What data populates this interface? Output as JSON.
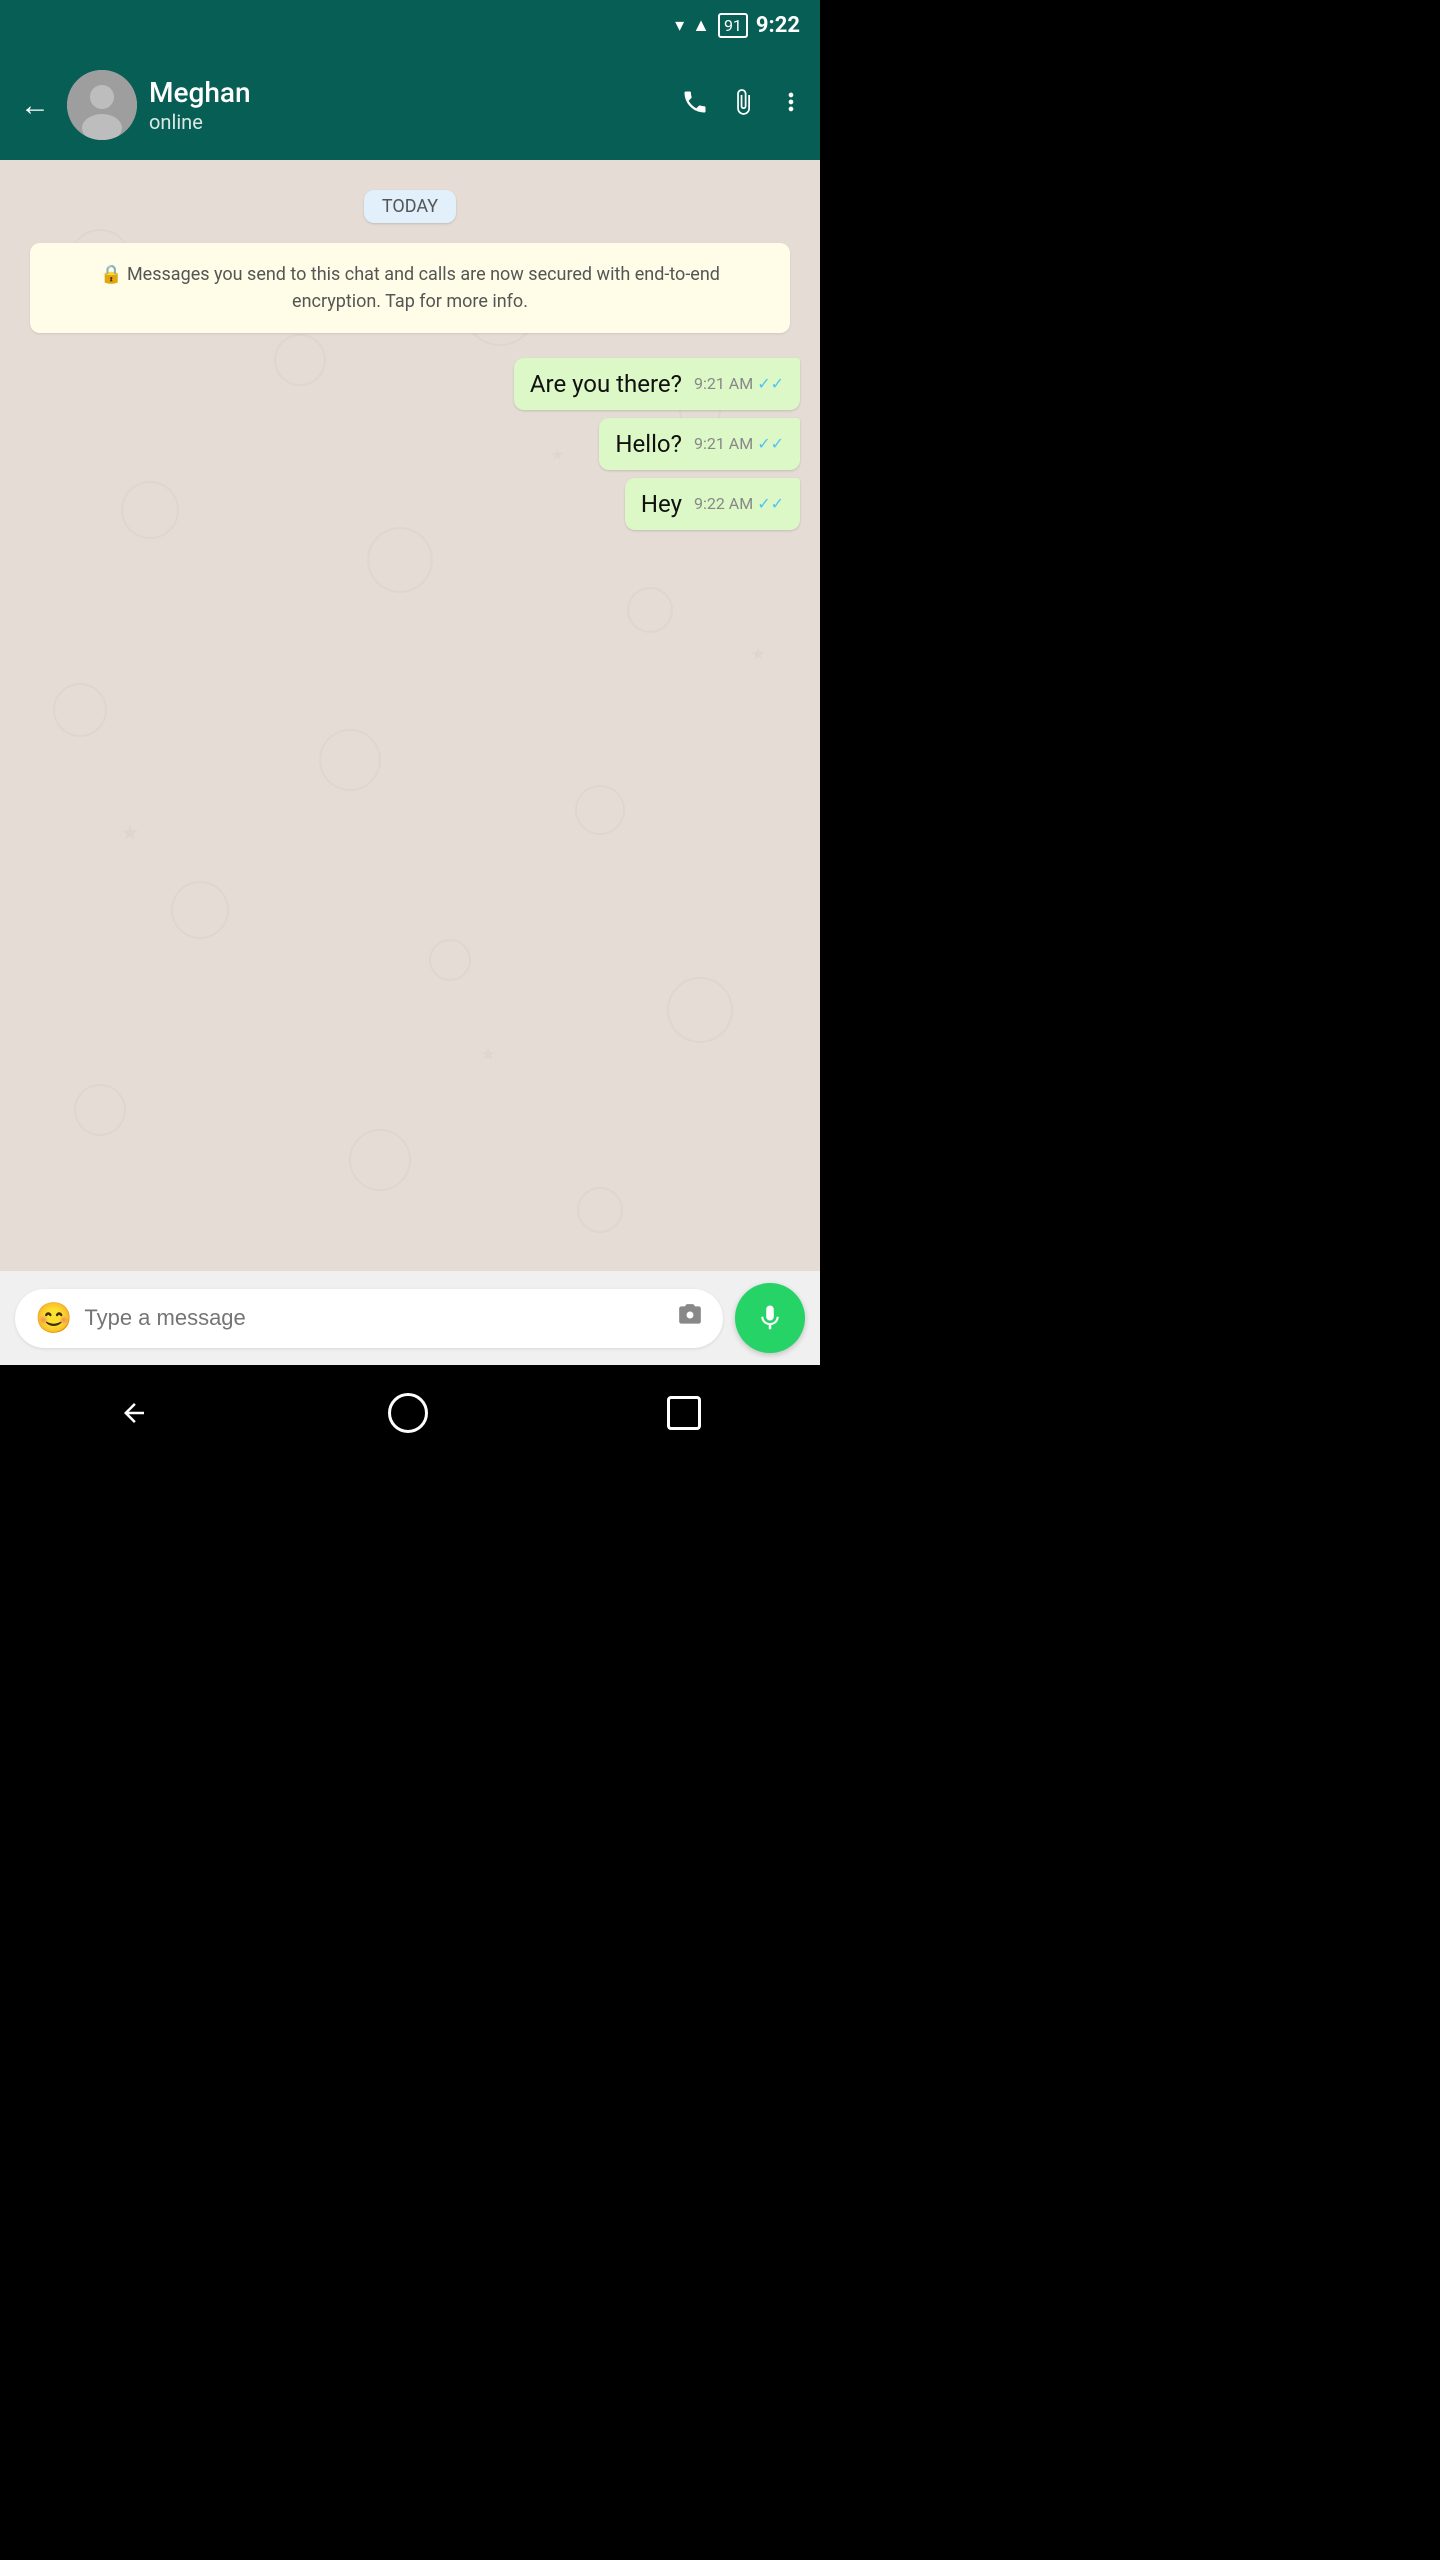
{
  "statusBar": {
    "time": "9:22",
    "batteryLevel": "91"
  },
  "header": {
    "backLabel": "←",
    "contactName": "Meghan",
    "contactStatus": "online",
    "callIcon": "📞",
    "attachIcon": "📎",
    "moreIcon": "⋮"
  },
  "chat": {
    "dateSeparator": "TODAY",
    "encryptionNotice": "Messages you send to this chat and calls are now secured with end-to-end encryption. Tap for more info.",
    "messages": [
      {
        "id": 1,
        "text": "Are you there?",
        "time": "9:21 AM",
        "type": "sent",
        "status": "read"
      },
      {
        "id": 2,
        "text": "Hello?",
        "time": "9:21 AM",
        "type": "sent",
        "status": "read"
      },
      {
        "id": 3,
        "text": "Hey",
        "time": "9:22 AM",
        "type": "sent",
        "status": "read"
      }
    ]
  },
  "inputArea": {
    "placeholder": "Type a message",
    "emojiIcon": "😊",
    "cameraIcon": "📷",
    "micIcon": "🎤"
  },
  "navBar": {
    "backLabel": "◀"
  }
}
